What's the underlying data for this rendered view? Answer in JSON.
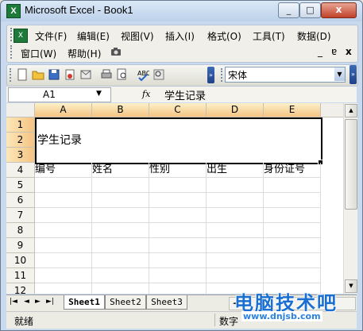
{
  "window": {
    "title": "Microsoft Excel - Book1",
    "app_icon": "X",
    "btn_min": "_",
    "btn_max": "□",
    "btn_close": "x"
  },
  "menubar": {
    "row1": [
      "文件(F)",
      "编辑(E)",
      "视图(V)",
      "插入(I)",
      "格式(O)",
      "工具(T)",
      "数据(D)"
    ],
    "row2": [
      "窗口(W)",
      "帮助(H)"
    ],
    "doc_min": "_",
    "doc_restore": "ɐ",
    "doc_close": "x"
  },
  "toolbar": {
    "font_name": "宋体"
  },
  "formula_bar": {
    "name_box": "A1",
    "fx": "fx",
    "content": "学生记录"
  },
  "grid": {
    "columns": [
      "A",
      "B",
      "C",
      "D",
      "E"
    ],
    "rows": [
      "1",
      "2",
      "3",
      "4",
      "5",
      "6",
      "7",
      "8",
      "9",
      "10",
      "11",
      "12"
    ],
    "merged_title": "学生记录",
    "header_row": [
      "编号",
      "姓名",
      "性别",
      "出生",
      "身份证号"
    ]
  },
  "sheets": {
    "tabs": [
      "Sheet1",
      "Sheet2",
      "Sheet3"
    ],
    "nav": [
      "|◄",
      "◄",
      "►",
      "►|"
    ]
  },
  "status": {
    "left": "就绪",
    "right": "数字"
  },
  "watermark": {
    "text": "电脑技术吧",
    "url": "www.dnjsb.com"
  }
}
